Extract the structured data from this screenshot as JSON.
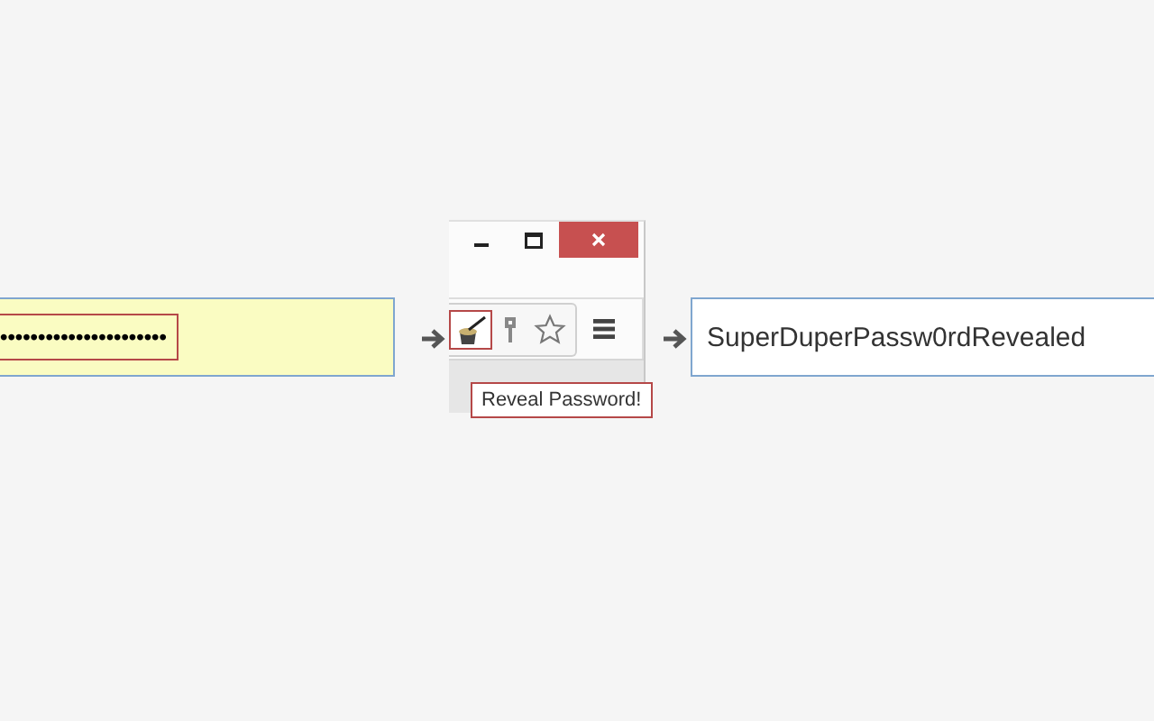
{
  "masked_field": {
    "value": "••••••••••••••••••••••",
    "highlighted": true
  },
  "browser": {
    "toolbar_icons": [
      {
        "kind": "reveal",
        "highlighted": true
      },
      {
        "kind": "key",
        "highlighted": false
      },
      {
        "kind": "star",
        "highlighted": false
      }
    ],
    "tooltip": "Reveal Password!"
  },
  "revealed_field": {
    "value": "SuperDuperPassw0rdRevealed"
  }
}
